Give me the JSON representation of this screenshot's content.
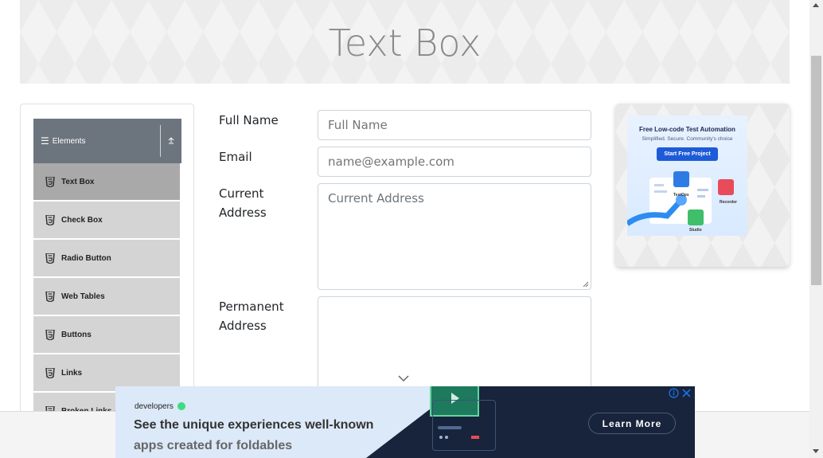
{
  "header": {
    "title": "Text Box"
  },
  "sidebar": {
    "group_title": "Elements",
    "items": [
      {
        "label": "Text Box"
      },
      {
        "label": "Check Box"
      },
      {
        "label": "Radio Button"
      },
      {
        "label": "Web Tables"
      },
      {
        "label": "Buttons"
      },
      {
        "label": "Links"
      },
      {
        "label": "Broken Links - Images"
      }
    ]
  },
  "form": {
    "full_name": {
      "label": "Full Name",
      "placeholder": "Full Name"
    },
    "email": {
      "label": "Email",
      "placeholder": "name@example.com"
    },
    "current_address": {
      "label_line1": "Current",
      "label_line2": "Address",
      "placeholder": "Current Address"
    },
    "permanent_address": {
      "label_line1": "Permanent",
      "label_line2": "Address",
      "placeholder": ""
    }
  },
  "side_ad": {
    "title": "Free Low-code Test Automation",
    "subtitle": "Simplified. Secure. Community's choice",
    "button": "Start Free Project",
    "labels": [
      "TestOps",
      "Recorder",
      "Studio"
    ]
  },
  "bottom_ad": {
    "brand": "developers",
    "headline": "See the unique experiences well-known",
    "subline": "apps created for foldables",
    "cta": "Learn More"
  },
  "colors": {
    "header_bg": "#6c757d",
    "active_item": "#a9a9a9",
    "item_bg": "#d4d4d4",
    "ad_cta_bg": "#17243b"
  }
}
